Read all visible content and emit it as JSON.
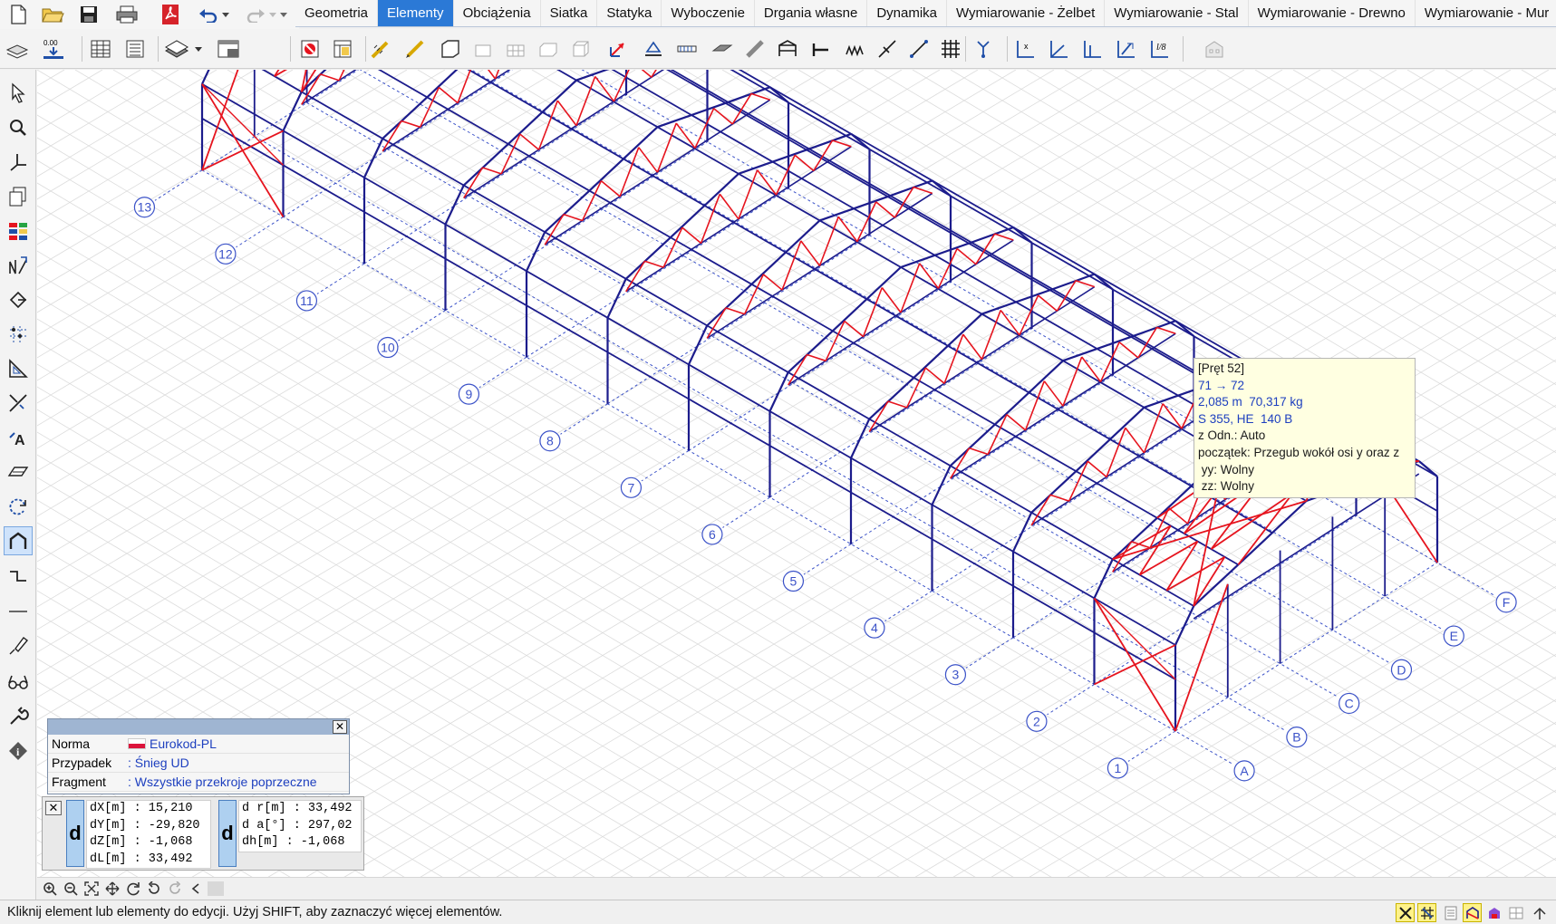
{
  "quick_access": {
    "buttons": [
      "new-file-icon",
      "open-folder-icon",
      "save-icon",
      "print-icon",
      "pdf-icon",
      "undo-icon",
      "undo-dropdown-icon",
      "redo-icon",
      "redo-dropdown-icon",
      "customize-dropdown-icon"
    ]
  },
  "menu": {
    "tabs": [
      {
        "label": "Geometria",
        "active": false
      },
      {
        "label": "Elementy",
        "active": true
      },
      {
        "label": "Obciążenia",
        "active": false
      },
      {
        "label": "Siatka",
        "active": false
      },
      {
        "label": "Statyka",
        "active": false
      },
      {
        "label": "Wyboczenie",
        "active": false
      },
      {
        "label": "Drgania własne",
        "active": false
      },
      {
        "label": "Dynamika",
        "active": false
      },
      {
        "label": "Wymiarowanie - Żelbet",
        "active": false
      },
      {
        "label": "Wymiarowanie - Stal",
        "active": false
      },
      {
        "label": "Wymiarowanie - Drewno",
        "active": false
      },
      {
        "label": "Wymiarowanie - Mur",
        "active": false
      }
    ]
  },
  "toolbar": {
    "left_buttons": [
      "layers-icon",
      "level-icon",
      "table-icon",
      "list-icon",
      "sections-icon",
      "sections-dropdown-icon",
      "window-icon"
    ],
    "level_text": "0.00",
    "element_buttons": [
      "node-load-icon",
      "properties-icon",
      "beam-draw-icon",
      "bar-draw-icon",
      "wall-icon",
      "plate-icon",
      "shell-icon",
      "slab-icon",
      "solid-icon",
      "vector-icon",
      "support-icon",
      "rib-icon",
      "surface-icon",
      "inclined-bar-icon",
      "frame-icon",
      "hinge-icon",
      "spring-icon",
      "link-icon",
      "rigid-link-icon",
      "grid-icon",
      "node-tools-icon",
      "local-x-icon",
      "local-y-icon",
      "local-z-icon",
      "section-axis-icon",
      "cable-icon",
      "building-icon"
    ]
  },
  "left_tools": [
    "pointer-icon",
    "zoom-icon",
    "axes-icon",
    "copy-icon",
    "layers-color-icon",
    "dimension-icon",
    "node-icon",
    "grid-points-icon",
    "triangle-icon",
    "cut-icon",
    "text-icon",
    "plane-icon",
    "rotate-icon",
    "frame-view-icon",
    "connect-icon",
    "line-icon",
    "measure-icon",
    "glasses-icon",
    "wrench-icon",
    "info-icon"
  ],
  "grid_axes": {
    "numbers": [
      "1",
      "2",
      "3",
      "4",
      "5",
      "6",
      "7",
      "8",
      "9",
      "10",
      "11",
      "12",
      "13"
    ],
    "letters": [
      "A",
      "B",
      "C",
      "D",
      "E",
      "F"
    ]
  },
  "tooltip": {
    "lines": [
      {
        "text": "[Pręt 52]",
        "color": "#1a1a1a"
      },
      {
        "text": "71 → 72",
        "color": "#1d3fbf"
      },
      {
        "text": "2,085 m  70,317 kg",
        "color": "#1d3fbf"
      },
      {
        "text": "S 355, HE  140 B",
        "color": "#1d3fbf"
      },
      {
        "text": "z Odn.: Auto",
        "color": "#1a1a1a"
      },
      {
        "text": "początek: Przegub wokół osi y oraz z",
        "color": "#1a1a1a"
      },
      {
        "text": " yy: Wolny",
        "color": "#1a1a1a"
      },
      {
        "text": " zz: Wolny",
        "color": "#1a1a1a"
      }
    ]
  },
  "info_panel": {
    "rows": [
      {
        "label": "Norma",
        "value": "Eurokod-PL",
        "has_flag": true
      },
      {
        "label": "Przypadek",
        "value": ": Śnieg UD",
        "has_flag": false
      },
      {
        "label": "Fragment",
        "value": ": Wszystkie przekroje poprzeczne",
        "has_flag": false
      }
    ],
    "close_label": "✕"
  },
  "coords": {
    "close_label": "✕",
    "d_label": "d",
    "cartesian": [
      "dX[m] : 15,210",
      "dY[m] : -29,820",
      "dZ[m] : -1,068",
      "dL[m] : 33,492"
    ],
    "polar": [
      "d r[m] : 33,492",
      "d a[°] : 297,02",
      "dh[m] : -1,068"
    ]
  },
  "nav_bar": [
    "zoom-in-icon",
    "zoom-out-icon",
    "fit-icon",
    "pan-icon",
    "rotate-view-icon",
    "previous-view-icon",
    "next-view-icon",
    "scroll-left-icon"
  ],
  "status": {
    "text": "Kliknij element lub elementy do edycji. Użyj SHIFT, aby zaznaczyć więcej elementów.",
    "buttons": [
      "snap-on-icon",
      "snap-grid-icon",
      "table-view-icon",
      "structure-view-icon",
      "render-icon",
      "window-split-icon",
      "expand-icon"
    ]
  },
  "colors": {
    "frame_blue": "#1c1c8c",
    "bracing_red": "#e6141e",
    "selected_magenta": "#b014d6",
    "grid_line": "#dcdcdc",
    "axis_dotted": "#3b52c8",
    "active_tab": "#2b79d6"
  }
}
